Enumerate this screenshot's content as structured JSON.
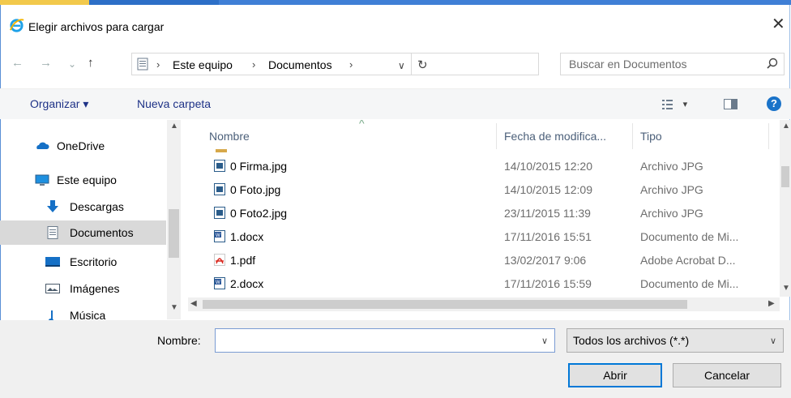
{
  "window": {
    "title": "Elegir archivos para cargar",
    "close_glyph": "✕"
  },
  "nav": {
    "back_glyph": "←",
    "forward_glyph": "→",
    "recent_glyph": "⌄",
    "up_glyph": "↑",
    "breadcrumb": [
      "Este equipo",
      "Documentos"
    ],
    "sep_glyph": "›",
    "dropdown_glyph": "∨",
    "refresh_glyph": "↻",
    "search_placeholder": "Buscar en Documentos"
  },
  "toolbar": {
    "organize_label": "Organizar ▾",
    "new_folder_label": "Nueva carpeta",
    "view_glyph": "▾",
    "help_glyph": "?"
  },
  "sidebar": {
    "items": [
      {
        "label": "OneDrive",
        "icon": "cloud-icon"
      },
      {
        "label": "Este equipo",
        "icon": "computer-icon"
      },
      {
        "label": "Descargas",
        "icon": "download-icon"
      },
      {
        "label": "Documentos",
        "icon": "documents-icon",
        "selected": true
      },
      {
        "label": "Escritorio",
        "icon": "desktop-icon"
      },
      {
        "label": "Imágenes",
        "icon": "pictures-icon"
      },
      {
        "label": "Música",
        "icon": "music-icon"
      }
    ]
  },
  "file_list": {
    "columns": [
      "Nombre",
      "Fecha de modifica...",
      "Tipo"
    ],
    "rows": [
      {
        "name": "0 Firma.jpg",
        "date": "14/10/2015 12:20",
        "type": "Archivo JPG",
        "icon": "image-file-icon"
      },
      {
        "name": "0 Foto.jpg",
        "date": "14/10/2015 12:09",
        "type": "Archivo JPG",
        "icon": "image-file-icon"
      },
      {
        "name": "0 Foto2.jpg",
        "date": "23/11/2015 11:39",
        "type": "Archivo JPG",
        "icon": "image-file-icon"
      },
      {
        "name": "1.docx",
        "date": "17/11/2016 15:51",
        "type": "Documento de Mi...",
        "icon": "word-file-icon"
      },
      {
        "name": "1.pdf",
        "date": "13/02/2017 9:06",
        "type": "Adobe Acrobat D...",
        "icon": "pdf-file-icon"
      },
      {
        "name": "2.docx",
        "date": "17/11/2016 15:59",
        "type": "Documento de Mi...",
        "icon": "word-file-icon"
      }
    ]
  },
  "footer": {
    "name_label": "Nombre:",
    "name_value": "",
    "filter_value": "Todos los archivos (*.*)",
    "open_label": "Abrir",
    "cancel_label": "Cancelar"
  },
  "colors": {
    "accent": "#0078d7",
    "link_text": "#1e3287"
  }
}
